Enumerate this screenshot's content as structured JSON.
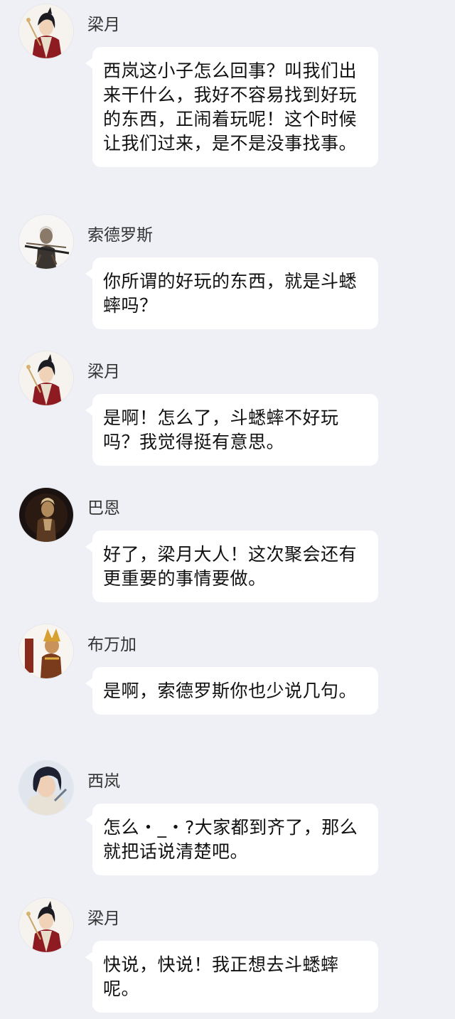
{
  "messages": [
    {
      "sender": "梁月",
      "avatar_icon": "lingyue-avatar-icon",
      "text": "西岚这小子怎么回事？叫我们出来干什么，我好不容易找到好玩的东西，正闹着玩呢！这个时候让我们过来，是不是没事找事。"
    },
    {
      "sender": "索德罗斯",
      "avatar_icon": "suoderosi-avatar-icon",
      "text": "你所谓的好玩的东西，就是斗蟋蟀吗？"
    },
    {
      "sender": "梁月",
      "avatar_icon": "lingyue-avatar-icon",
      "text": "是啊！怎么了，斗蟋蟀不好玩吗？我觉得挺有意思。"
    },
    {
      "sender": "巴恩",
      "avatar_icon": "baen-avatar-icon",
      "text": "好了，梁月大人！这次聚会还有更重要的事情要做。"
    },
    {
      "sender": "布万加",
      "avatar_icon": "buwanjia-avatar-icon",
      "text": "是啊，索德罗斯你也少说几句。"
    },
    {
      "sender": "西岚",
      "avatar_icon": "xilan-avatar-icon",
      "text": "怎么・_・?大家都到齐了，那么就把话说清楚吧。"
    },
    {
      "sender": "梁月",
      "avatar_icon": "lingyue-avatar-icon",
      "text": "快说，快说！我正想去斗蟋蟀呢。"
    }
  ]
}
